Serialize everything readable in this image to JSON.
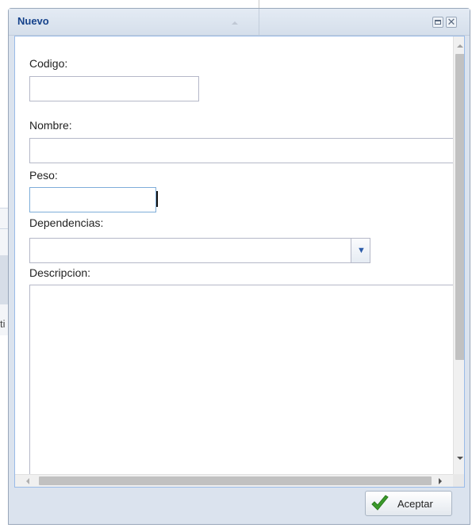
{
  "window": {
    "title": "Nuevo",
    "tools": {
      "maximize_icon": "maximize-icon",
      "close_icon": "close-icon",
      "close_glyph": "✕"
    }
  },
  "form": {
    "codigo": {
      "label": "Codigo:",
      "value": ""
    },
    "nombre": {
      "label": "Nombre:",
      "value": ""
    },
    "peso": {
      "label": "Peso:",
      "value": ""
    },
    "dependencias": {
      "label": "Dependencias:",
      "value": ""
    },
    "descripcion": {
      "label": "Descripcion:",
      "value": ""
    }
  },
  "footer": {
    "accept_label": "Aceptar"
  },
  "background": {
    "fragment_text": "ti"
  },
  "colors": {
    "title": "#15428b",
    "field_border": "#b5b8c8",
    "accept_check": "#3a9a2a"
  }
}
